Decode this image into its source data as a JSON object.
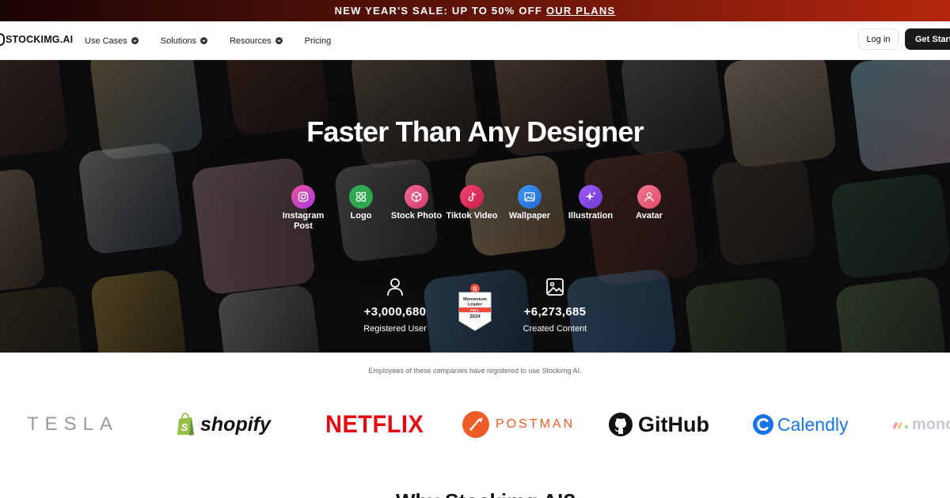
{
  "promo": {
    "text": "NEW YEAR'S SALE: UP TO 50% OFF",
    "link": "OUR PLANS"
  },
  "nav": {
    "logo": "STOCKIMG.AI",
    "menu": [
      {
        "label": "Use Cases",
        "dropdown": true
      },
      {
        "label": "Solutions",
        "dropdown": true
      },
      {
        "label": "Resources",
        "dropdown": true
      },
      {
        "label": "Pricing",
        "dropdown": false
      }
    ],
    "login": "Log in",
    "get_started": "Get Started"
  },
  "hero": {
    "title": "Faster Than Any Designer",
    "categories": [
      {
        "label": "Instagram Post",
        "icon": "instagram-icon",
        "color": "#c13cc8"
      },
      {
        "label": "Logo",
        "icon": "grid-icon",
        "color": "#2fa84f"
      },
      {
        "label": "Stock Photo",
        "icon": "cube-icon",
        "color": "#e4508a"
      },
      {
        "label": "Tiktok Video",
        "icon": "tiktok-icon",
        "color": "#e8416b"
      },
      {
        "label": "Wallpaper",
        "icon": "image-icon",
        "color": "#2f83e6"
      },
      {
        "label": "Illustration",
        "icon": "sparkle-icon",
        "color": "#8b4be8"
      },
      {
        "label": "Avatar",
        "icon": "user-icon",
        "color": "#ef5a7a"
      }
    ],
    "stats": [
      {
        "value": "+3,000,680",
        "caption": "Registered User",
        "icon": "user-icon"
      },
      {
        "value": "+6,273,685",
        "caption": "Created Content",
        "icon": "image-icon"
      }
    ],
    "badge": {
      "top": "Momentum Leader",
      "season": "FALL",
      "year": "2024",
      "accent": "#ef4a3c"
    }
  },
  "companies": {
    "caption": "Employees of these companies have registered to use Stockimg AI.",
    "logos": [
      "TESLA",
      "shopify",
      "NETFLIX",
      "POSTMAN",
      "GitHub",
      "Calendly",
      "monday"
    ]
  },
  "next_section_title": "Why Stockimg AI?"
}
